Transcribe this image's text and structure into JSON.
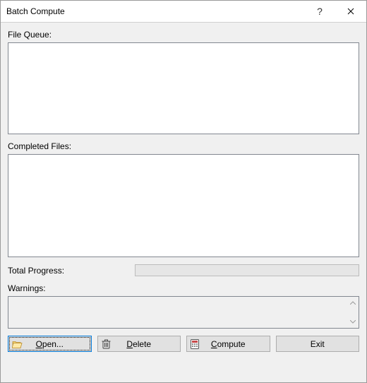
{
  "window": {
    "title": "Batch Compute"
  },
  "labels": {
    "file_queue": "File Queue:",
    "completed_files": "Completed Files:",
    "total_progress": "Total Progress:",
    "warnings": "Warnings:"
  },
  "buttons": {
    "open": "Open...",
    "delete": "Delete",
    "compute": "Compute",
    "exit": "Exit"
  },
  "progress": {
    "percent": 0
  }
}
